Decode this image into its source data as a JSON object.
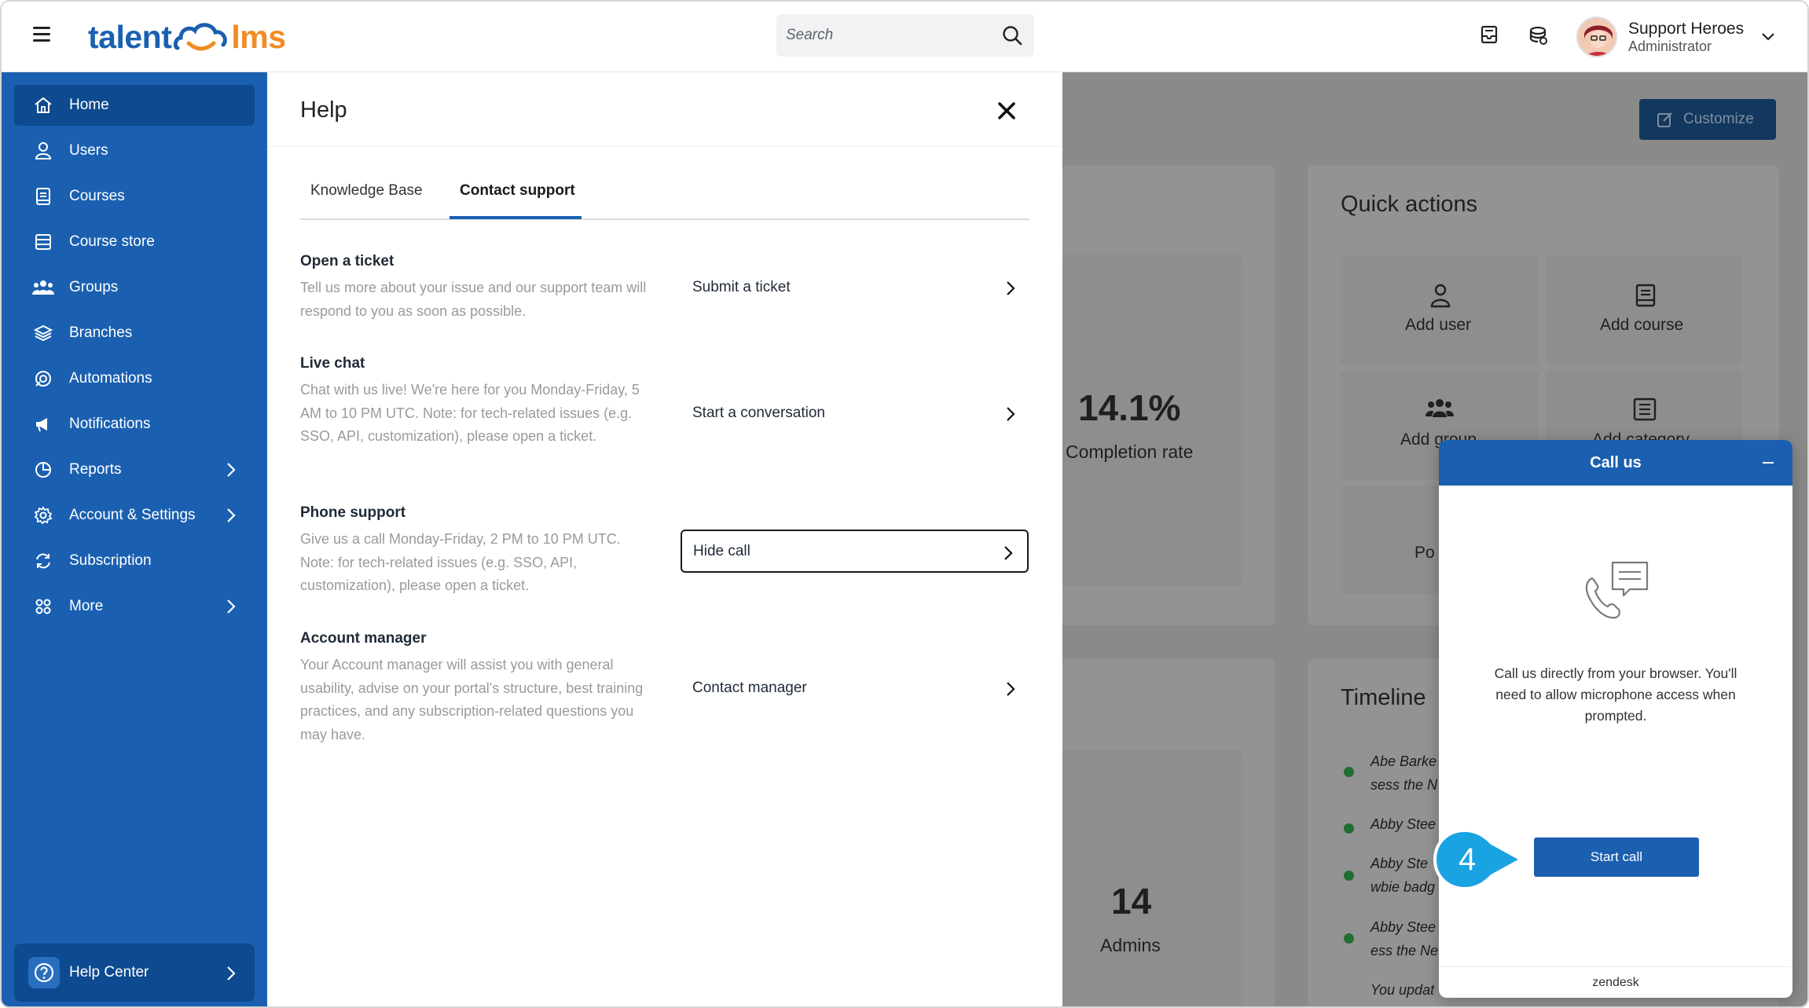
{
  "header": {
    "logo_left": "talent",
    "logo_right": "lms",
    "search_placeholder": "Search",
    "user_name": "Support Heroes",
    "user_role": "Administrator"
  },
  "sidebar": {
    "items": [
      {
        "label": "Home",
        "icon": "home-icon",
        "active": true
      },
      {
        "label": "Users",
        "icon": "user-icon"
      },
      {
        "label": "Courses",
        "icon": "book-icon"
      },
      {
        "label": "Course store",
        "icon": "store-icon"
      },
      {
        "label": "Groups",
        "icon": "group-icon"
      },
      {
        "label": "Branches",
        "icon": "layers-icon"
      },
      {
        "label": "Automations",
        "icon": "automation-icon"
      },
      {
        "label": "Notifications",
        "icon": "megaphone-icon"
      },
      {
        "label": "Reports",
        "icon": "pie-chart-icon",
        "has_submenu": true
      },
      {
        "label": "Account & Settings",
        "icon": "gear-icon",
        "has_submenu": true
      },
      {
        "label": "Subscription",
        "icon": "refresh-icon"
      },
      {
        "label": "More",
        "icon": "grid-icon",
        "has_submenu": true
      }
    ],
    "help_center": "Help Center"
  },
  "dashboard": {
    "customize_label": "Customize",
    "quick_actions_title": "Quick actions",
    "quick_actions": [
      "Add user",
      "Add course",
      "Add group",
      "Add category",
      "Po"
    ],
    "completion_value": "14.1%",
    "completion_label": "Completion rate",
    "admins_value": "14",
    "admins_label": "Admins",
    "timeline_title": "Timeline",
    "timeline_items": [
      "Abe Barke",
      "sess the N",
      "Abby Stee",
      "Abby Ste",
      "wbie badg",
      "Abby Stee",
      "ess the Ne",
      "You updat"
    ]
  },
  "help": {
    "title": "Help",
    "tabs": [
      "Knowledge Base",
      "Contact support"
    ],
    "active_tab": "Contact support",
    "sections": [
      {
        "title": "Open a ticket",
        "description": "Tell us more about your issue and our support team will respond to you as soon as possible.",
        "action": "Submit a ticket"
      },
      {
        "title": "Live chat",
        "description": "Chat with us live! We're here for you Monday-Friday, 5 AM to 10 PM UTC. Note: for tech-related issues (e.g. SSO, API, customization), please open a ticket.",
        "action": "Start a conversation"
      },
      {
        "title": "Phone support",
        "description": "Give us a call Monday-Friday, 2 PM to 10 PM UTC. Note: for tech-related issues (e.g. SSO, API, customization), please open a ticket.",
        "action": "Hide call"
      },
      {
        "title": "Account manager",
        "description": "Your Account manager will assist you with general usability, advise on your portal's structure, best training practices, and any subscription-related questions you may have.",
        "action": "Contact manager"
      }
    ]
  },
  "call_widget": {
    "title": "Call us",
    "body": "Call us directly from your browser. You'll need to allow microphone access when prompted.",
    "button": "Start call",
    "footer": "zendesk"
  },
  "step_marker": "4",
  "colors": {
    "brand_blue": "#1b60b0",
    "sidebar_active": "#0e4a8f",
    "logo_orange": "#f08c23",
    "marker_cyan": "#1aa3e3"
  }
}
